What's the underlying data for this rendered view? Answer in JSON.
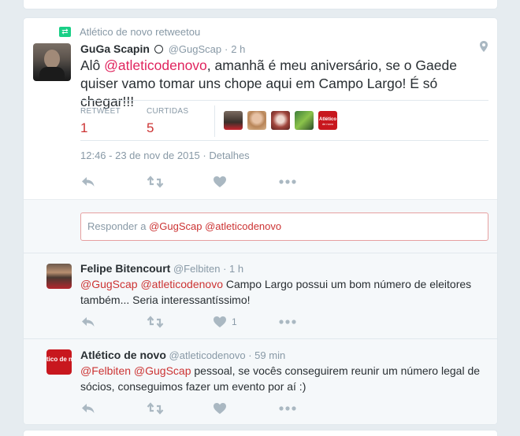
{
  "retweet_context": "Atlético de novo retweetou",
  "tweet": {
    "name": "GuGa Scapin",
    "handle": "@GugScap",
    "time": "2 h",
    "text_pre": "Alô ",
    "mention": "@atleticodenovo",
    "text_post": ", amanhã é meu aniversário, se o Gaede quiser vamo tomar uns chope aqui em Campo Largo! É só chegar!!!",
    "retweet_label": "RETWEET",
    "retweet_count": "1",
    "likes_label": "CURTIDAS",
    "likes_count": "5",
    "timestamp": "12:46 - 23 de nov de 2015",
    "details": "Detalhes"
  },
  "reply_box": {
    "prefix": "Responder a ",
    "mentions": "@GugScap @atleticodenovo"
  },
  "replies": [
    {
      "name": "Felipe Bitencourt",
      "handle": "@Felbiten",
      "time": "1 h",
      "mentions": "@GugScap @atleticodenovo",
      "text": " Campo Largo possui um bom número de eleitores também... Seria interessantíssimo!",
      "like_count": "1"
    },
    {
      "name": "Atlético de novo",
      "handle": "@atleticodenovo",
      "time": "59 min",
      "mentions": "@Felbiten @GugScap",
      "text": " pessoal, se vocês conseguirem reunir um número legal de sócios, conseguimos fazer um evento por aí :)"
    }
  ],
  "avatar_label": "Atlético de novo",
  "colors": {
    "accent": "#cc3333",
    "muted": "#8899a6",
    "retweet_green": "#19cf86",
    "background": "#e6ecf0"
  },
  "icons": [
    "retweet-icon",
    "location-pin-icon",
    "reply-icon",
    "retweet-icon",
    "heart-icon",
    "more-icon"
  ]
}
